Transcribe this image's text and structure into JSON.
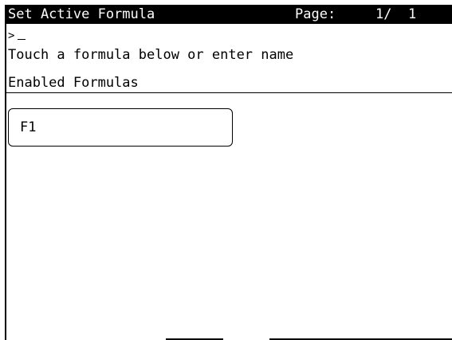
{
  "title_bar": {
    "title": "Set Active Formula",
    "page_label": "Page:",
    "page_value": "1/  1"
  },
  "prompt": {
    "symbol": ">"
  },
  "instruction": "Touch a formula below or enter name",
  "section": {
    "title": "Enabled Formulas"
  },
  "formulas": [
    {
      "label": "F1"
    }
  ],
  "colors": {
    "background": "#ffffff",
    "foreground": "#000000",
    "title_bar_bg": "#000000",
    "title_bar_fg": "#ffffff"
  }
}
